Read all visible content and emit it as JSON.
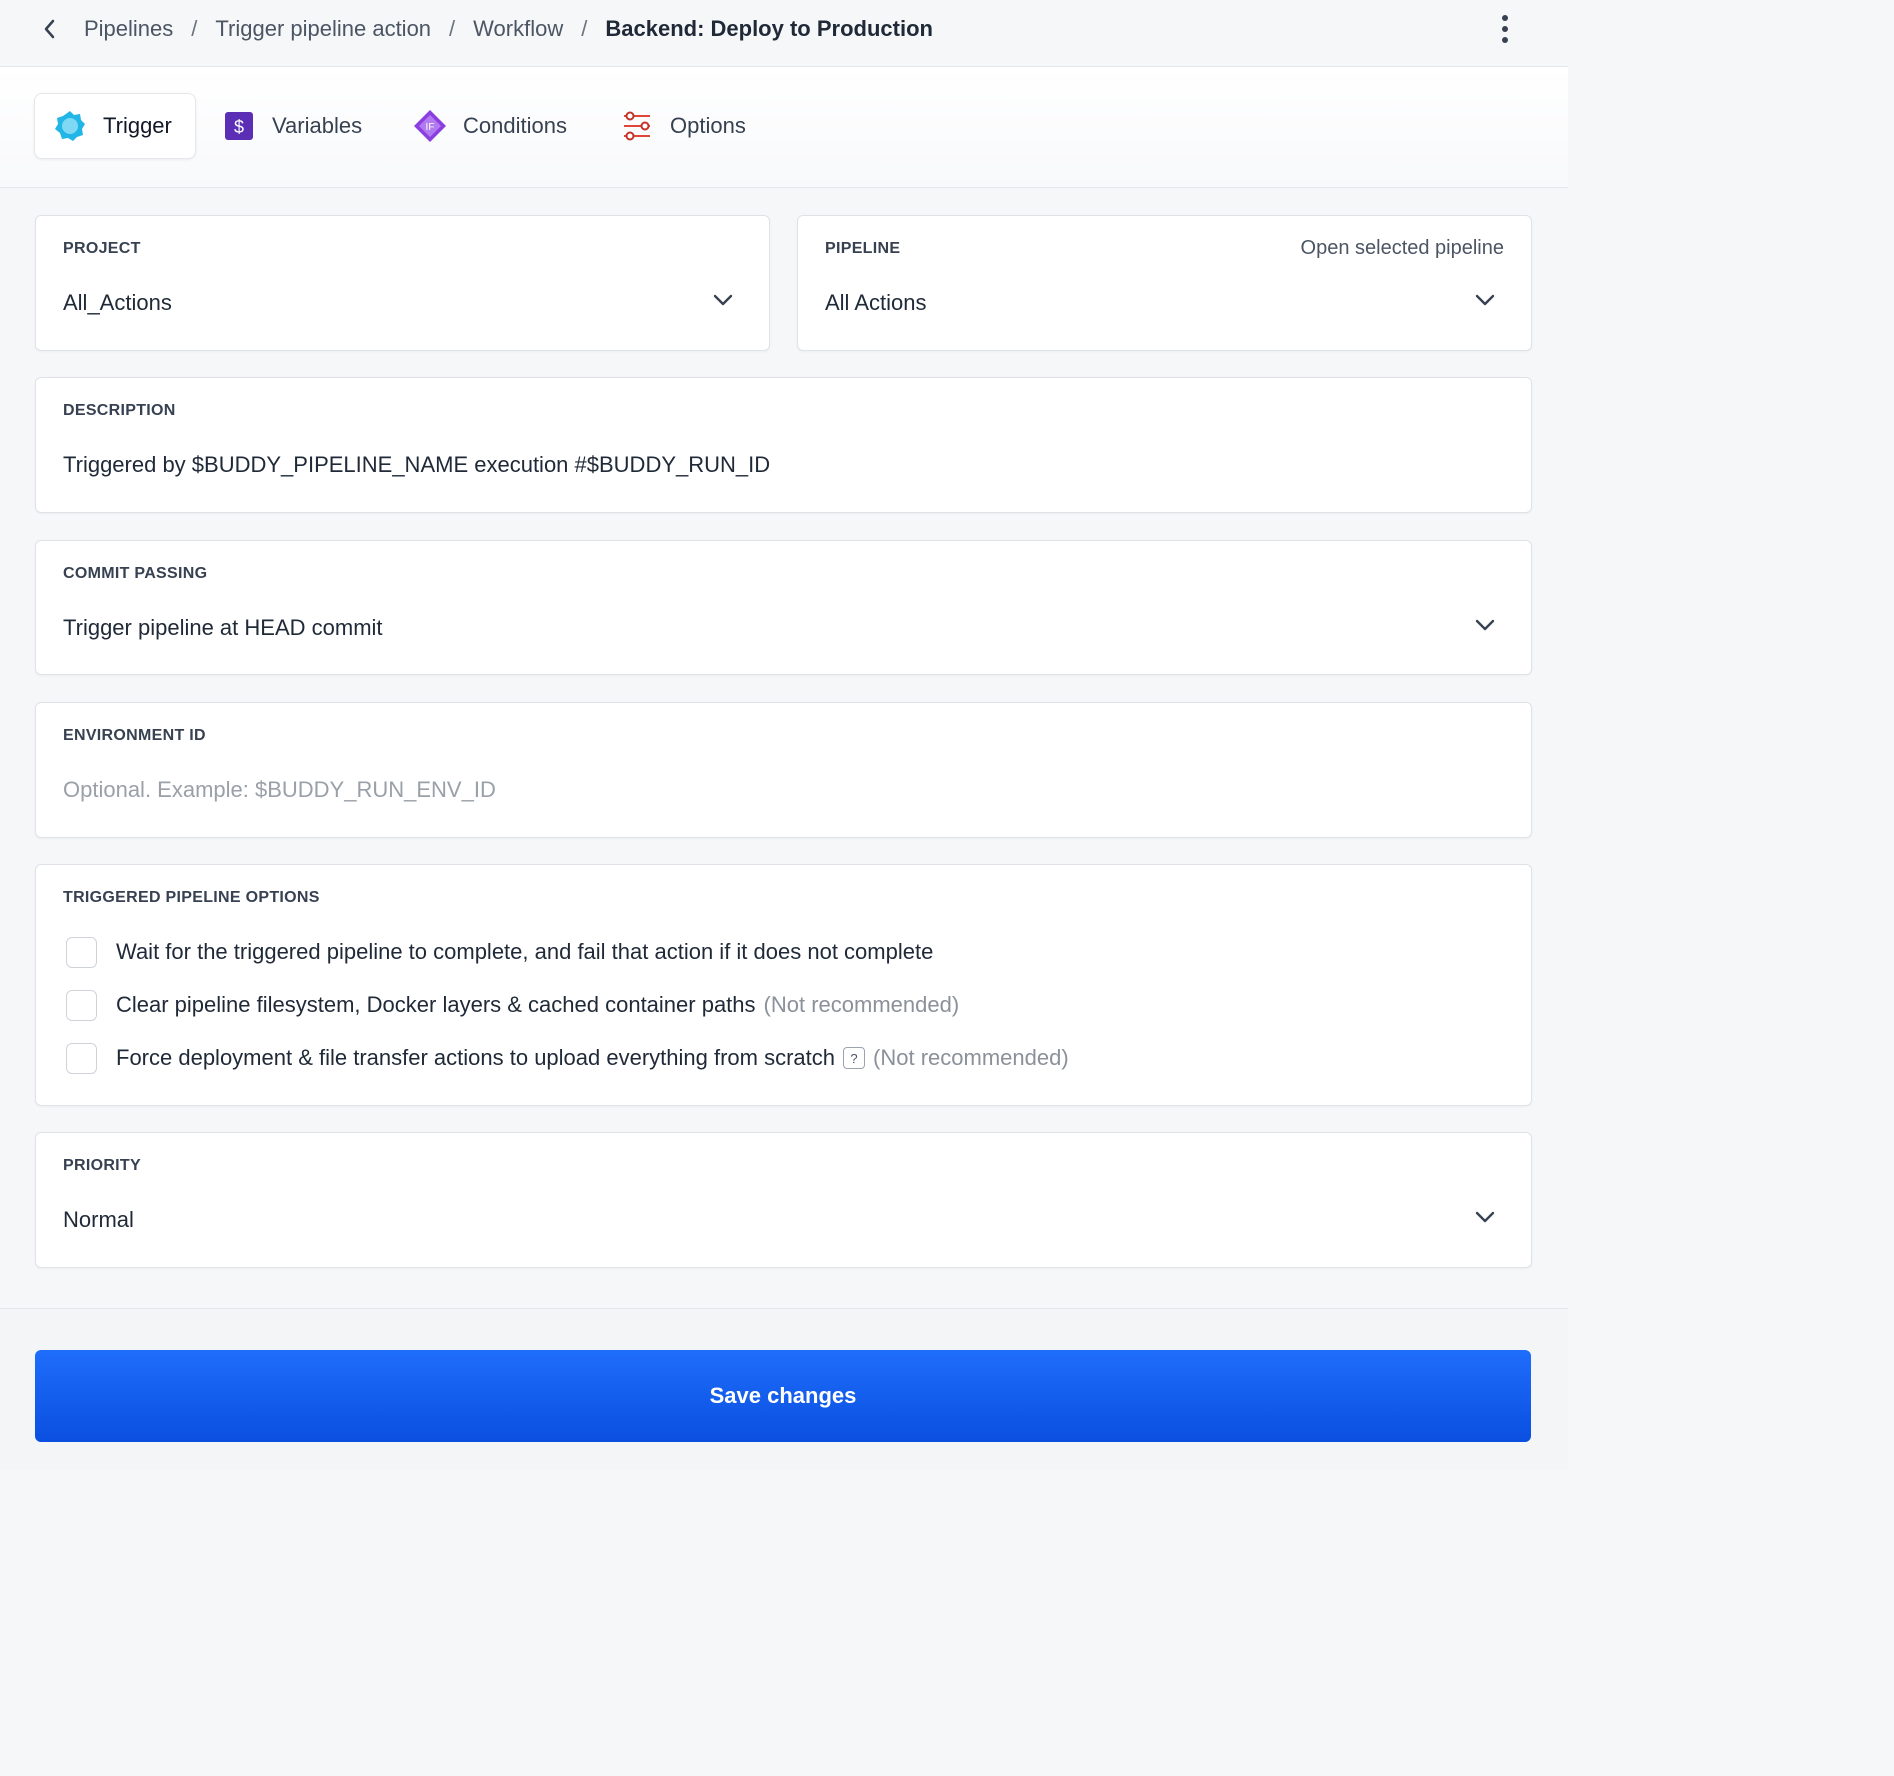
{
  "breadcrumb": {
    "items": [
      "Pipelines",
      "Trigger pipeline action",
      "Workflow"
    ],
    "current": "Backend: Deploy to Production",
    "separator": "/"
  },
  "tabs": [
    {
      "label": "Trigger",
      "icon": "trigger-gear-icon",
      "active": true
    },
    {
      "label": "Variables",
      "icon": "dollar-icon",
      "active": false
    },
    {
      "label": "Conditions",
      "icon": "if-diamond-icon",
      "active": false
    },
    {
      "label": "Options",
      "icon": "sliders-icon",
      "active": false
    }
  ],
  "project": {
    "label": "PROJECT",
    "value": "All_Actions"
  },
  "pipeline": {
    "label": "PIPELINE",
    "value": "All Actions",
    "link": "Open selected pipeline"
  },
  "description": {
    "label": "DESCRIPTION",
    "value": "Triggered by $BUDDY_PIPELINE_NAME execution #$BUDDY_RUN_ID"
  },
  "commit_passing": {
    "label": "COMMIT PASSING",
    "value": "Trigger pipeline at HEAD commit"
  },
  "environment": {
    "label": "ENVIRONMENT ID",
    "placeholder": "Optional. Example: $BUDDY_RUN_ENV_ID"
  },
  "triggered_options": {
    "label": "TRIGGERED PIPELINE OPTIONS",
    "items": [
      {
        "text": "Wait for the triggered pipeline to complete, and fail that action if it does not complete",
        "note": "",
        "checked": false
      },
      {
        "text": "Clear pipeline filesystem, Docker layers & cached container paths",
        "note": "(Not recommended)",
        "checked": false
      },
      {
        "text": "Force deployment & file transfer actions to upload everything from scratch",
        "help": "?",
        "note": "(Not recommended)",
        "checked": false
      }
    ]
  },
  "priority": {
    "label": "PRIORITY",
    "value": "Normal"
  },
  "save_label": "Save changes",
  "colors": {
    "accent": "#1560f5",
    "variables_icon": "#5b2fb5",
    "conditions_icon": "#8b3fe0",
    "trigger_icon": "#21b6e6",
    "options_icon": "#e0453a"
  }
}
